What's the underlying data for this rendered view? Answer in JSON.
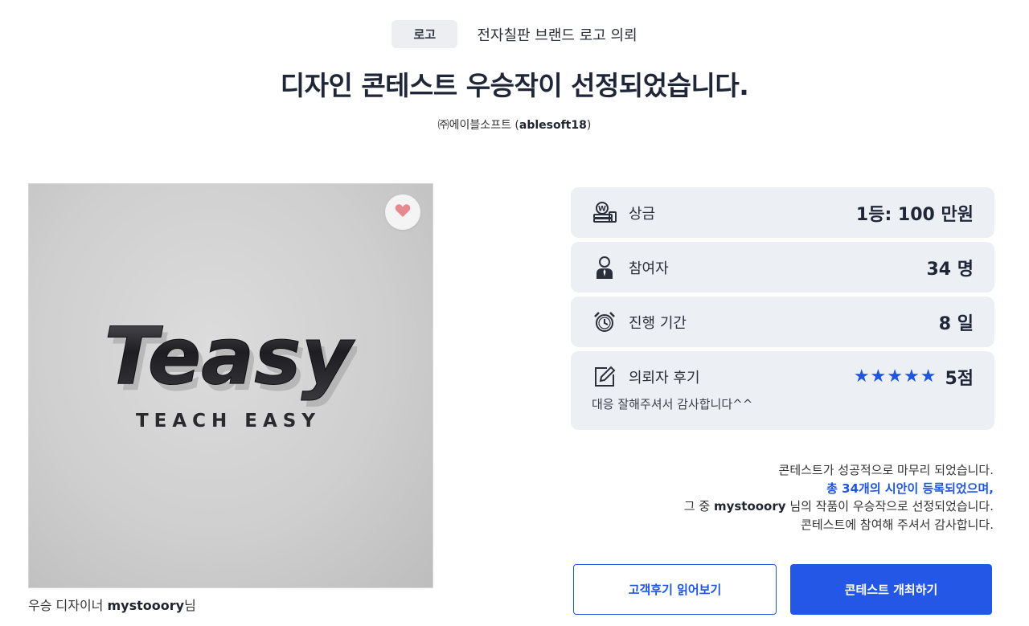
{
  "header": {
    "category": "로고",
    "subject": "전자칠판 브랜드 로고 의뢰",
    "title": "디자인 콘테스트 우승작이 선정되었습니다.",
    "client_name": "㈜에이블소프트 (",
    "client_id": "ablesoft18",
    "client_close": ")"
  },
  "winner": {
    "logo_main": "Teasy",
    "logo_sub": "TEACH EASY",
    "designer_prefix": "우승 디자이너 ",
    "designer_name": "mystooory",
    "designer_suffix": "님",
    "like_icon": "heart-icon"
  },
  "info": {
    "prize_label": "상금",
    "prize_value": "1등: 100 만원",
    "participants_label": "참여자",
    "participants_value": "34 명",
    "duration_label": "진행 기간",
    "duration_value": "8 일",
    "review_label": "의뢰자 후기",
    "review_stars": "★★★★★",
    "review_score": "5점",
    "review_rating": 5,
    "review_text": "대응 잘해주셔서 감사합니다^^"
  },
  "summary": {
    "line1": "콘테스트가 성공적으로 마무리 되었습니다.",
    "line2": "총 34개의 시안이 등록되었으며,",
    "line3_prefix": "그 중 ",
    "line3_name": "mystooory",
    "line3_suffix": " 님의 작품이 우승작으로 선정되었습니다.",
    "line4": "콘테스트에 참여해 주셔서 감사합니다."
  },
  "buttons": {
    "reviews": "고객후기 읽어보기",
    "host": "콘테스트 개최하기"
  },
  "colors": {
    "accent": "#2457e6",
    "card_bg": "#eceff3",
    "heart": "#e8898f"
  }
}
